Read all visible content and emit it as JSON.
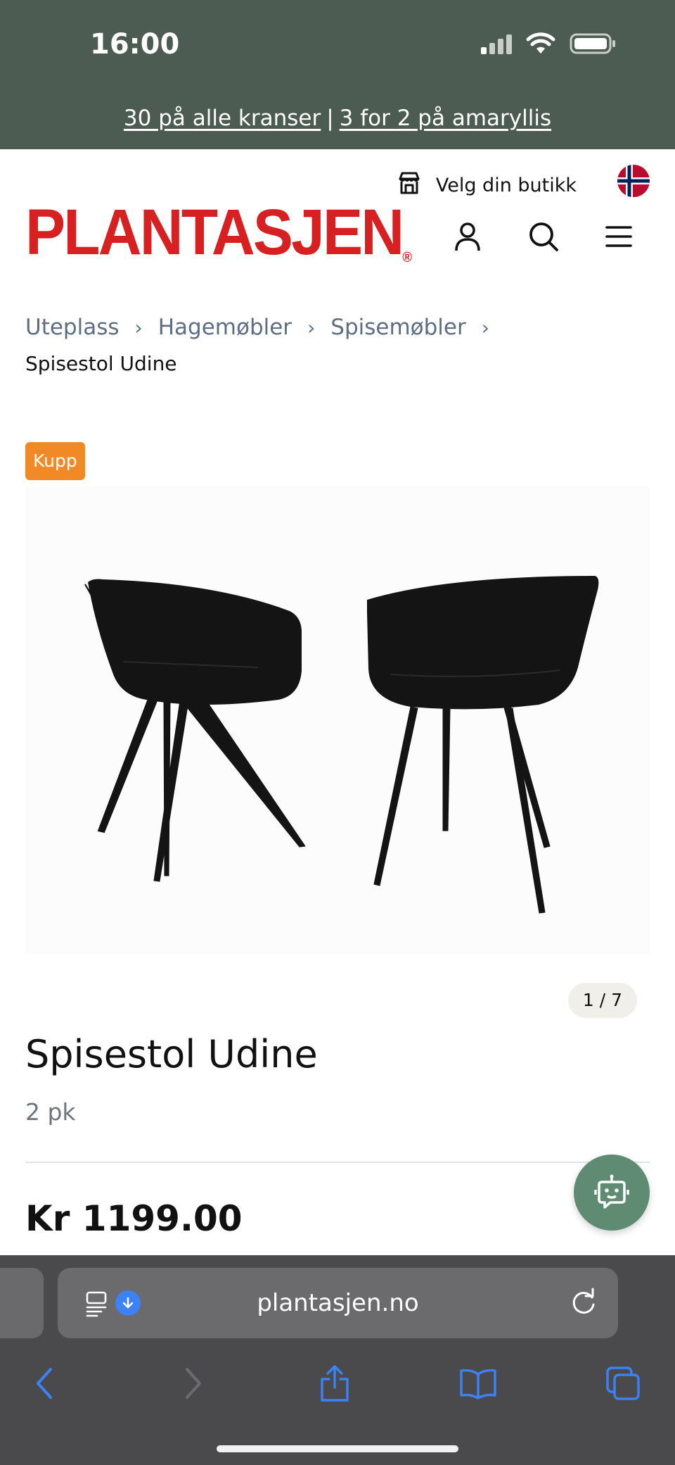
{
  "status_bar": {
    "time": "16:00"
  },
  "promo": {
    "link_1": "30 på alle kranser",
    "separator": "|",
    "link_2": "3 for 2 på amaryllis"
  },
  "header": {
    "store_label": "Velg din butikk",
    "logo_text": "PLANTASJEN",
    "logo_mark": "®",
    "icons": [
      "store-icon",
      "norway-flag-icon",
      "user-icon",
      "search-icon",
      "menu-icon"
    ]
  },
  "breadcrumb": {
    "items": [
      "Uteplass",
      "Hagemøbler",
      "Spisemøbler"
    ],
    "separator": "›",
    "current": "Spisestol Udine"
  },
  "product": {
    "badge": "Kupp",
    "image_counter": "1 / 7",
    "title": "Spisestol Udine",
    "subtitle": "2 pk",
    "price": "Kr 1199.00"
  },
  "browser": {
    "url": "plantasjen.no",
    "icons": [
      "reader-icon",
      "download-icon",
      "reload-icon",
      "back-icon",
      "forward-icon",
      "share-icon",
      "bookmarks-icon",
      "tabs-icon"
    ]
  },
  "colors": {
    "top_bar": "#4c5c52",
    "brand_red": "#d62021",
    "badge_orange": "#f18a26",
    "chatbot_green": "#5f8b72",
    "link_blue": "#3c82f6"
  }
}
